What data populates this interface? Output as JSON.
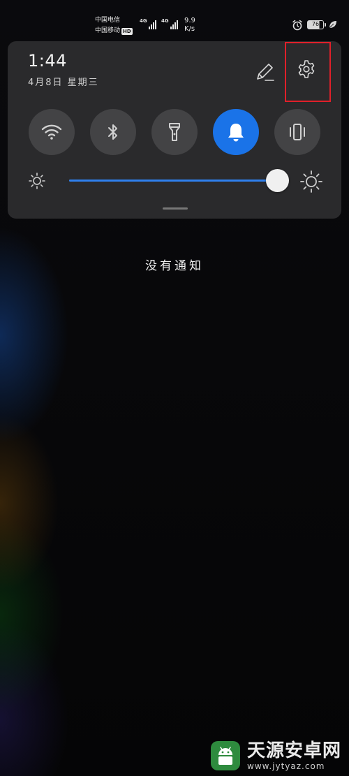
{
  "status_bar": {
    "carrier_1": "中国电信",
    "carrier_2": "中国移动",
    "hd_badge": "HD",
    "network_1": "4G",
    "network_2": "4G",
    "speed_value": "9.9",
    "speed_unit": "K/s",
    "battery_level": "76",
    "icons": [
      "alarm-icon",
      "leaf-icon"
    ]
  },
  "quick_panel": {
    "time": "1:44",
    "date": "4月8日 星期三",
    "edit_icon": "pencil-icon",
    "settings_icon": "gear-icon",
    "toggles": [
      {
        "name": "wifi",
        "icon": "wifi-icon",
        "active": false
      },
      {
        "name": "bluetooth",
        "icon": "bluetooth-icon",
        "active": false
      },
      {
        "name": "flashlight",
        "icon": "flashlight-icon",
        "active": false
      },
      {
        "name": "sound",
        "icon": "bell-icon",
        "active": true
      },
      {
        "name": "vibrate",
        "icon": "vibrate-icon",
        "active": false
      }
    ],
    "brightness_level": 0.98,
    "accent_color": "#1a73e8"
  },
  "notifications": {
    "empty_text": "没有通知"
  },
  "watermark": {
    "title": "天源安卓网",
    "url": "www.jytyaz.com"
  }
}
